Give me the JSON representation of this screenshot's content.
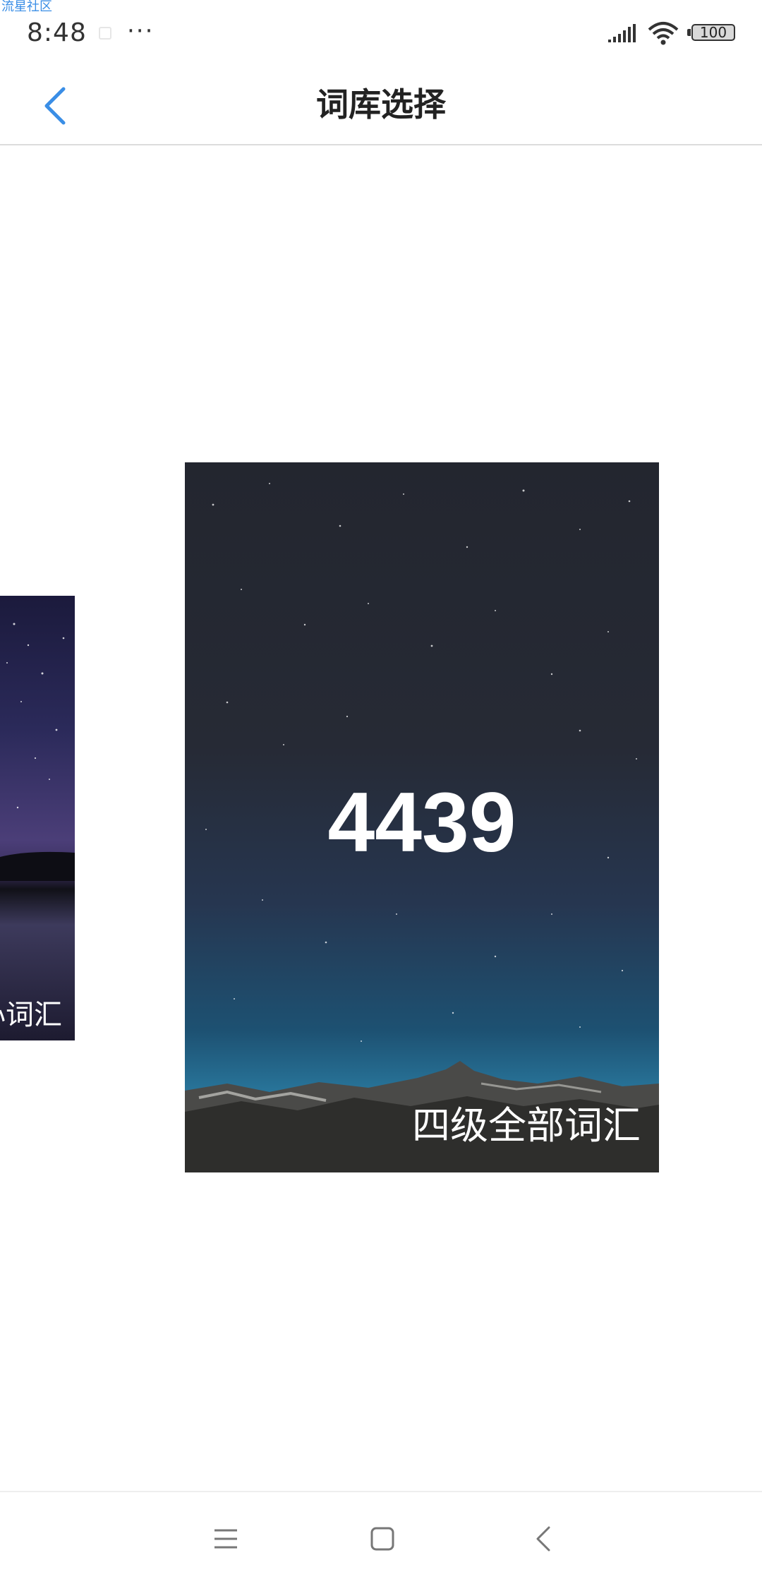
{
  "watermark": "流星社区",
  "status_bar": {
    "time": "8:48",
    "more": "···",
    "battery": "100"
  },
  "header": {
    "title": "词库选择"
  },
  "cards": [
    {
      "label": "核心词汇",
      "visible_label": "心词汇"
    },
    {
      "count": "4439",
      "label": "四级全部词汇"
    }
  ],
  "colors": {
    "accent": "#3a8ee6",
    "title": "#222222"
  },
  "icons": {
    "back": "chevron-left-icon",
    "menu": "hamburger-icon",
    "home": "square-icon",
    "nav_back": "chevron-left-icon"
  }
}
